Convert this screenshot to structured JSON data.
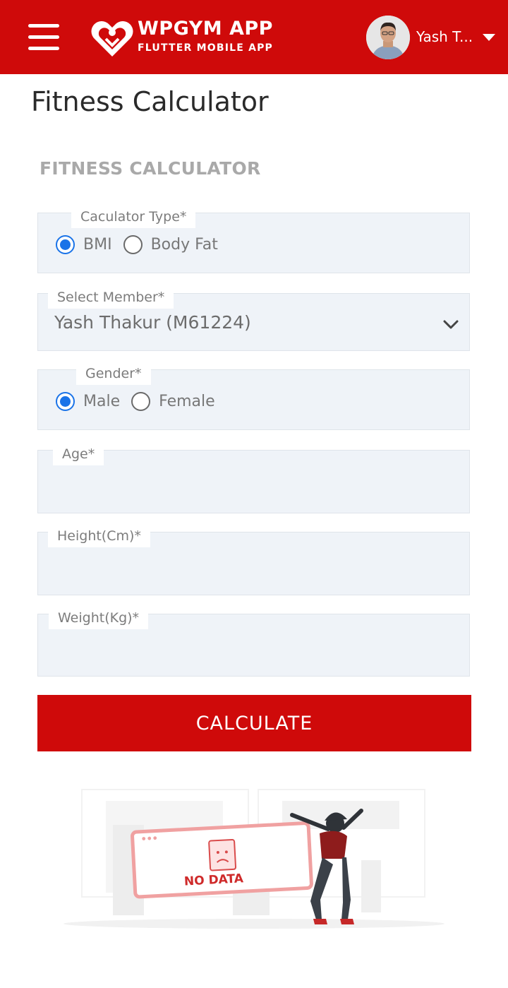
{
  "header": {
    "brand_title": "WPGYM APP",
    "brand_subtitle": "FLUTTER MOBILE APP",
    "user_name": "Yash T...",
    "menu_icon": "hamburger-menu-icon",
    "user_menu_icon": "caret-down-icon"
  },
  "page": {
    "title": "Fitness Calculator",
    "section_title": "FITNESS CALCULATOR"
  },
  "form": {
    "calculator_type": {
      "label": "Caculator Type*",
      "options": [
        "BMI",
        "Body Fat"
      ],
      "selected": "BMI"
    },
    "member": {
      "label": "Select Member*",
      "value": "Yash Thakur (M61224)"
    },
    "gender": {
      "label": "Gender*",
      "options": [
        "Male",
        "Female"
      ],
      "selected": "Male"
    },
    "age": {
      "label": "Age*",
      "value": ""
    },
    "height": {
      "label": "Height(Cm)*",
      "value": ""
    },
    "weight": {
      "label": "Weight(Kg)*",
      "value": ""
    },
    "submit_label": "CALCULATE"
  },
  "empty_state": {
    "text": "NO DATA"
  },
  "colors": {
    "brand_red": "#cf0a0a",
    "radio_blue": "#1a73e8",
    "field_bg": "#eff3f8",
    "muted_text": "#a9a9a9"
  }
}
